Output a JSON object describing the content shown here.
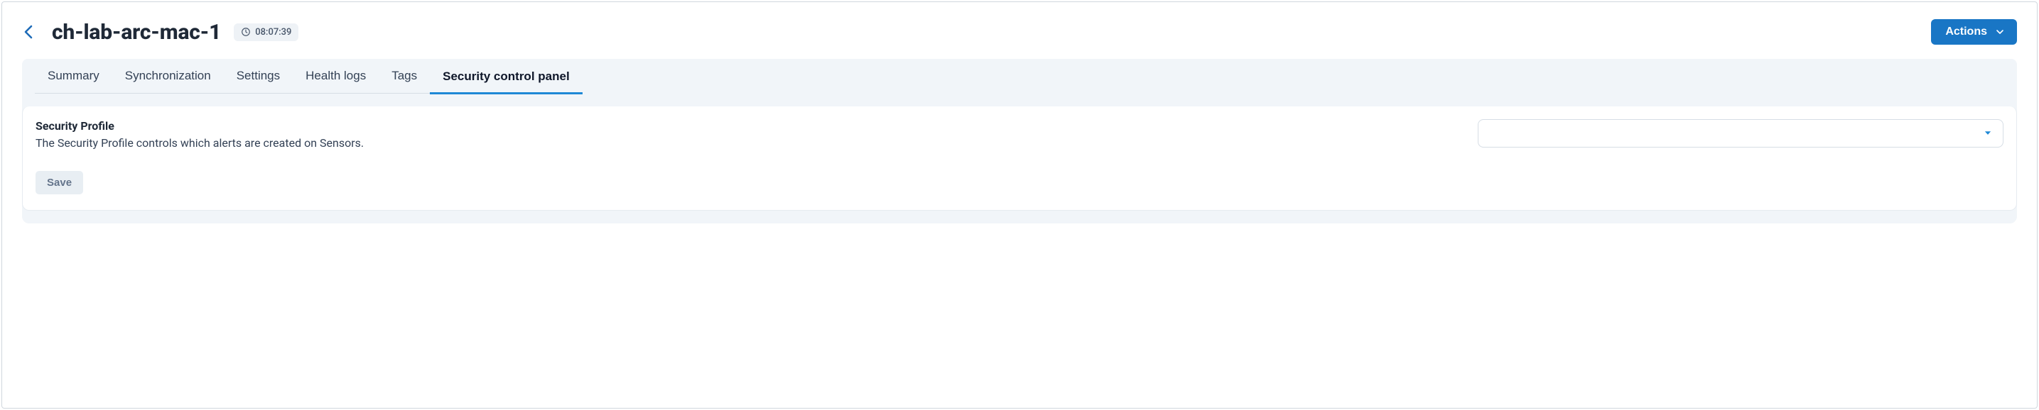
{
  "header": {
    "title": "ch-lab-arc-mac-1",
    "timestamp": "08:07:39",
    "actions_label": "Actions"
  },
  "tabs": [
    {
      "label": "Summary",
      "active": false
    },
    {
      "label": "Synchronization",
      "active": false
    },
    {
      "label": "Settings",
      "active": false
    },
    {
      "label": "Health logs",
      "active": false
    },
    {
      "label": "Tags",
      "active": false
    },
    {
      "label": "Security control panel",
      "active": true
    }
  ],
  "panel": {
    "profile_title": "Security Profile",
    "profile_desc": "The Security Profile controls which alerts are created on Sensors.",
    "select_value": "",
    "save_label": "Save"
  }
}
